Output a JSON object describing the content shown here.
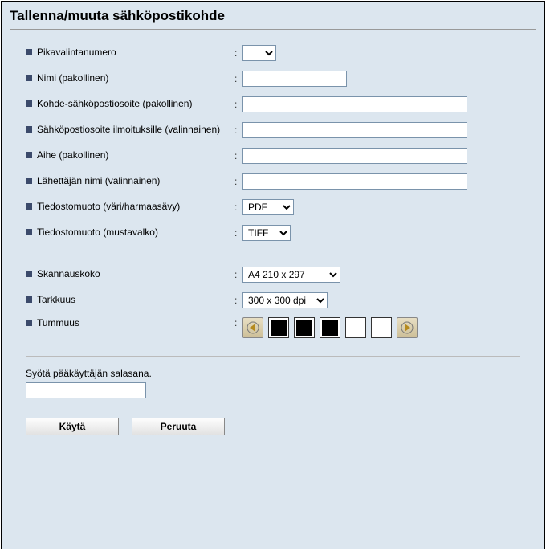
{
  "title": "Tallenna/muuta sähköpostikohde",
  "fields": {
    "speed_dial": {
      "label": "Pikavalintanumero",
      "value": ""
    },
    "name": {
      "label": "Nimi (pakollinen)",
      "value": ""
    },
    "target_email": {
      "label": "Kohde-sähköpostiosoite (pakollinen)",
      "value": ""
    },
    "notify_email": {
      "label": "Sähköpostiosoite ilmoituksille (valinnainen)",
      "value": ""
    },
    "subject": {
      "label": "Aihe (pakollinen)",
      "value": ""
    },
    "sender_name": {
      "label": "Lähettäjän nimi (valinnainen)",
      "value": ""
    },
    "format_color": {
      "label": "Tiedostomuoto (väri/harmaasävy)",
      "value": "PDF"
    },
    "format_bw": {
      "label": "Tiedostomuoto (mustavalko)",
      "value": "TIFF"
    },
    "scan_size": {
      "label": "Skannauskoko",
      "value": "A4 210 x 297"
    },
    "resolution": {
      "label": "Tarkkuus",
      "value": "300 x 300 dpi"
    },
    "darkness": {
      "label": "Tummuus"
    }
  },
  "admin": {
    "prompt": "Syötä pääkäyttäjän salasana.",
    "password": ""
  },
  "buttons": {
    "apply": "Käytä",
    "cancel": "Peruuta"
  }
}
